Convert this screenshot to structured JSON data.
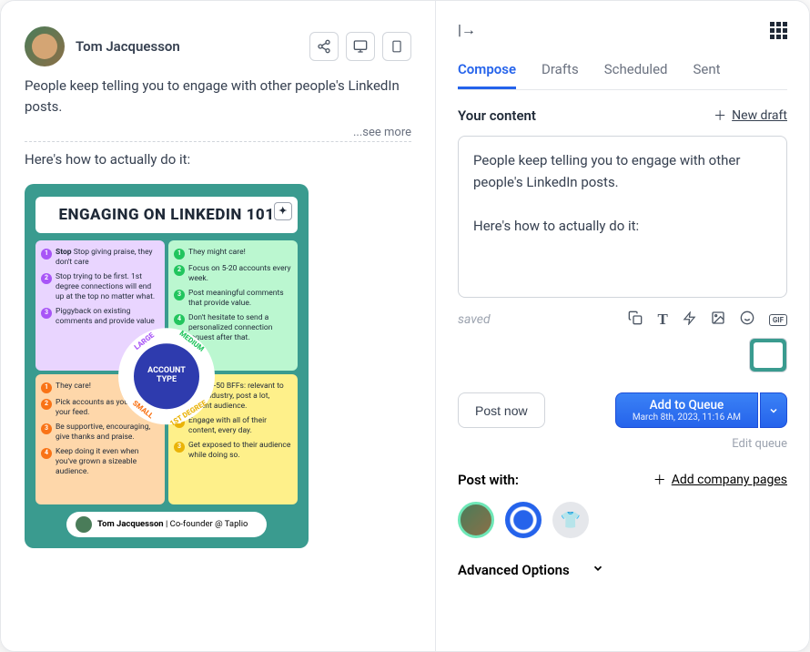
{
  "post": {
    "author": "Tom Jacquesson",
    "body": "People keep telling you to engage with other people's LinkedIn posts.",
    "see_more": "...see more",
    "followup": "Here's how to actually do it:"
  },
  "infographic": {
    "title": "ENGAGING ON LINKEDIN 101",
    "center1": "ACCOUNT",
    "center2": "TYPE",
    "rings": {
      "large": "LARGE",
      "medium": "MEDIUM",
      "small": "SMALL",
      "first": "1ST DEGREE"
    },
    "tl": [
      "Stop giving praise, they don't care",
      "Stop trying to be first. 1st degree connections will end up at the top no matter what.",
      "Piggyback on existing comments and provide value"
    ],
    "tr": [
      "They might care!",
      "Focus on 5-20 accounts every week.",
      "Post meaningful comments that provide value.",
      "Don't hesitate to send a personalized connection request after that."
    ],
    "bl": [
      "They care!",
      "Pick accounts as you scroll your feed.",
      "Be supportive, encouraging, give thanks and praise.",
      "Keep doing it even when you've grown a sizeable audience."
    ],
    "br": [
      "Pick 20-50 BFFs: relevant to your industry, post a lot, decent audience.",
      "Engage with all of their content, every day.",
      "Get exposed to their audience while doing so."
    ],
    "footer_name": "Tom Jacquesson",
    "footer_role": " | Co-founder @ Taplio"
  },
  "composer": {
    "tabs": [
      "Compose",
      "Drafts",
      "Scheduled",
      "Sent"
    ],
    "your_content": "Your content",
    "new_draft": "New draft",
    "content": "People keep telling you to engage with other people's LinkedIn posts.\n\nHere's how to actually do it:",
    "saved": "saved",
    "gif": "GIF",
    "post_now": "Post now",
    "queue_label": "Add to Queue",
    "queue_sub": "March 8th, 2023, 11:16 AM",
    "edit_queue": "Edit queue",
    "post_with": "Post with:",
    "add_pages": "Add company pages",
    "advanced": "Advanced Options"
  }
}
